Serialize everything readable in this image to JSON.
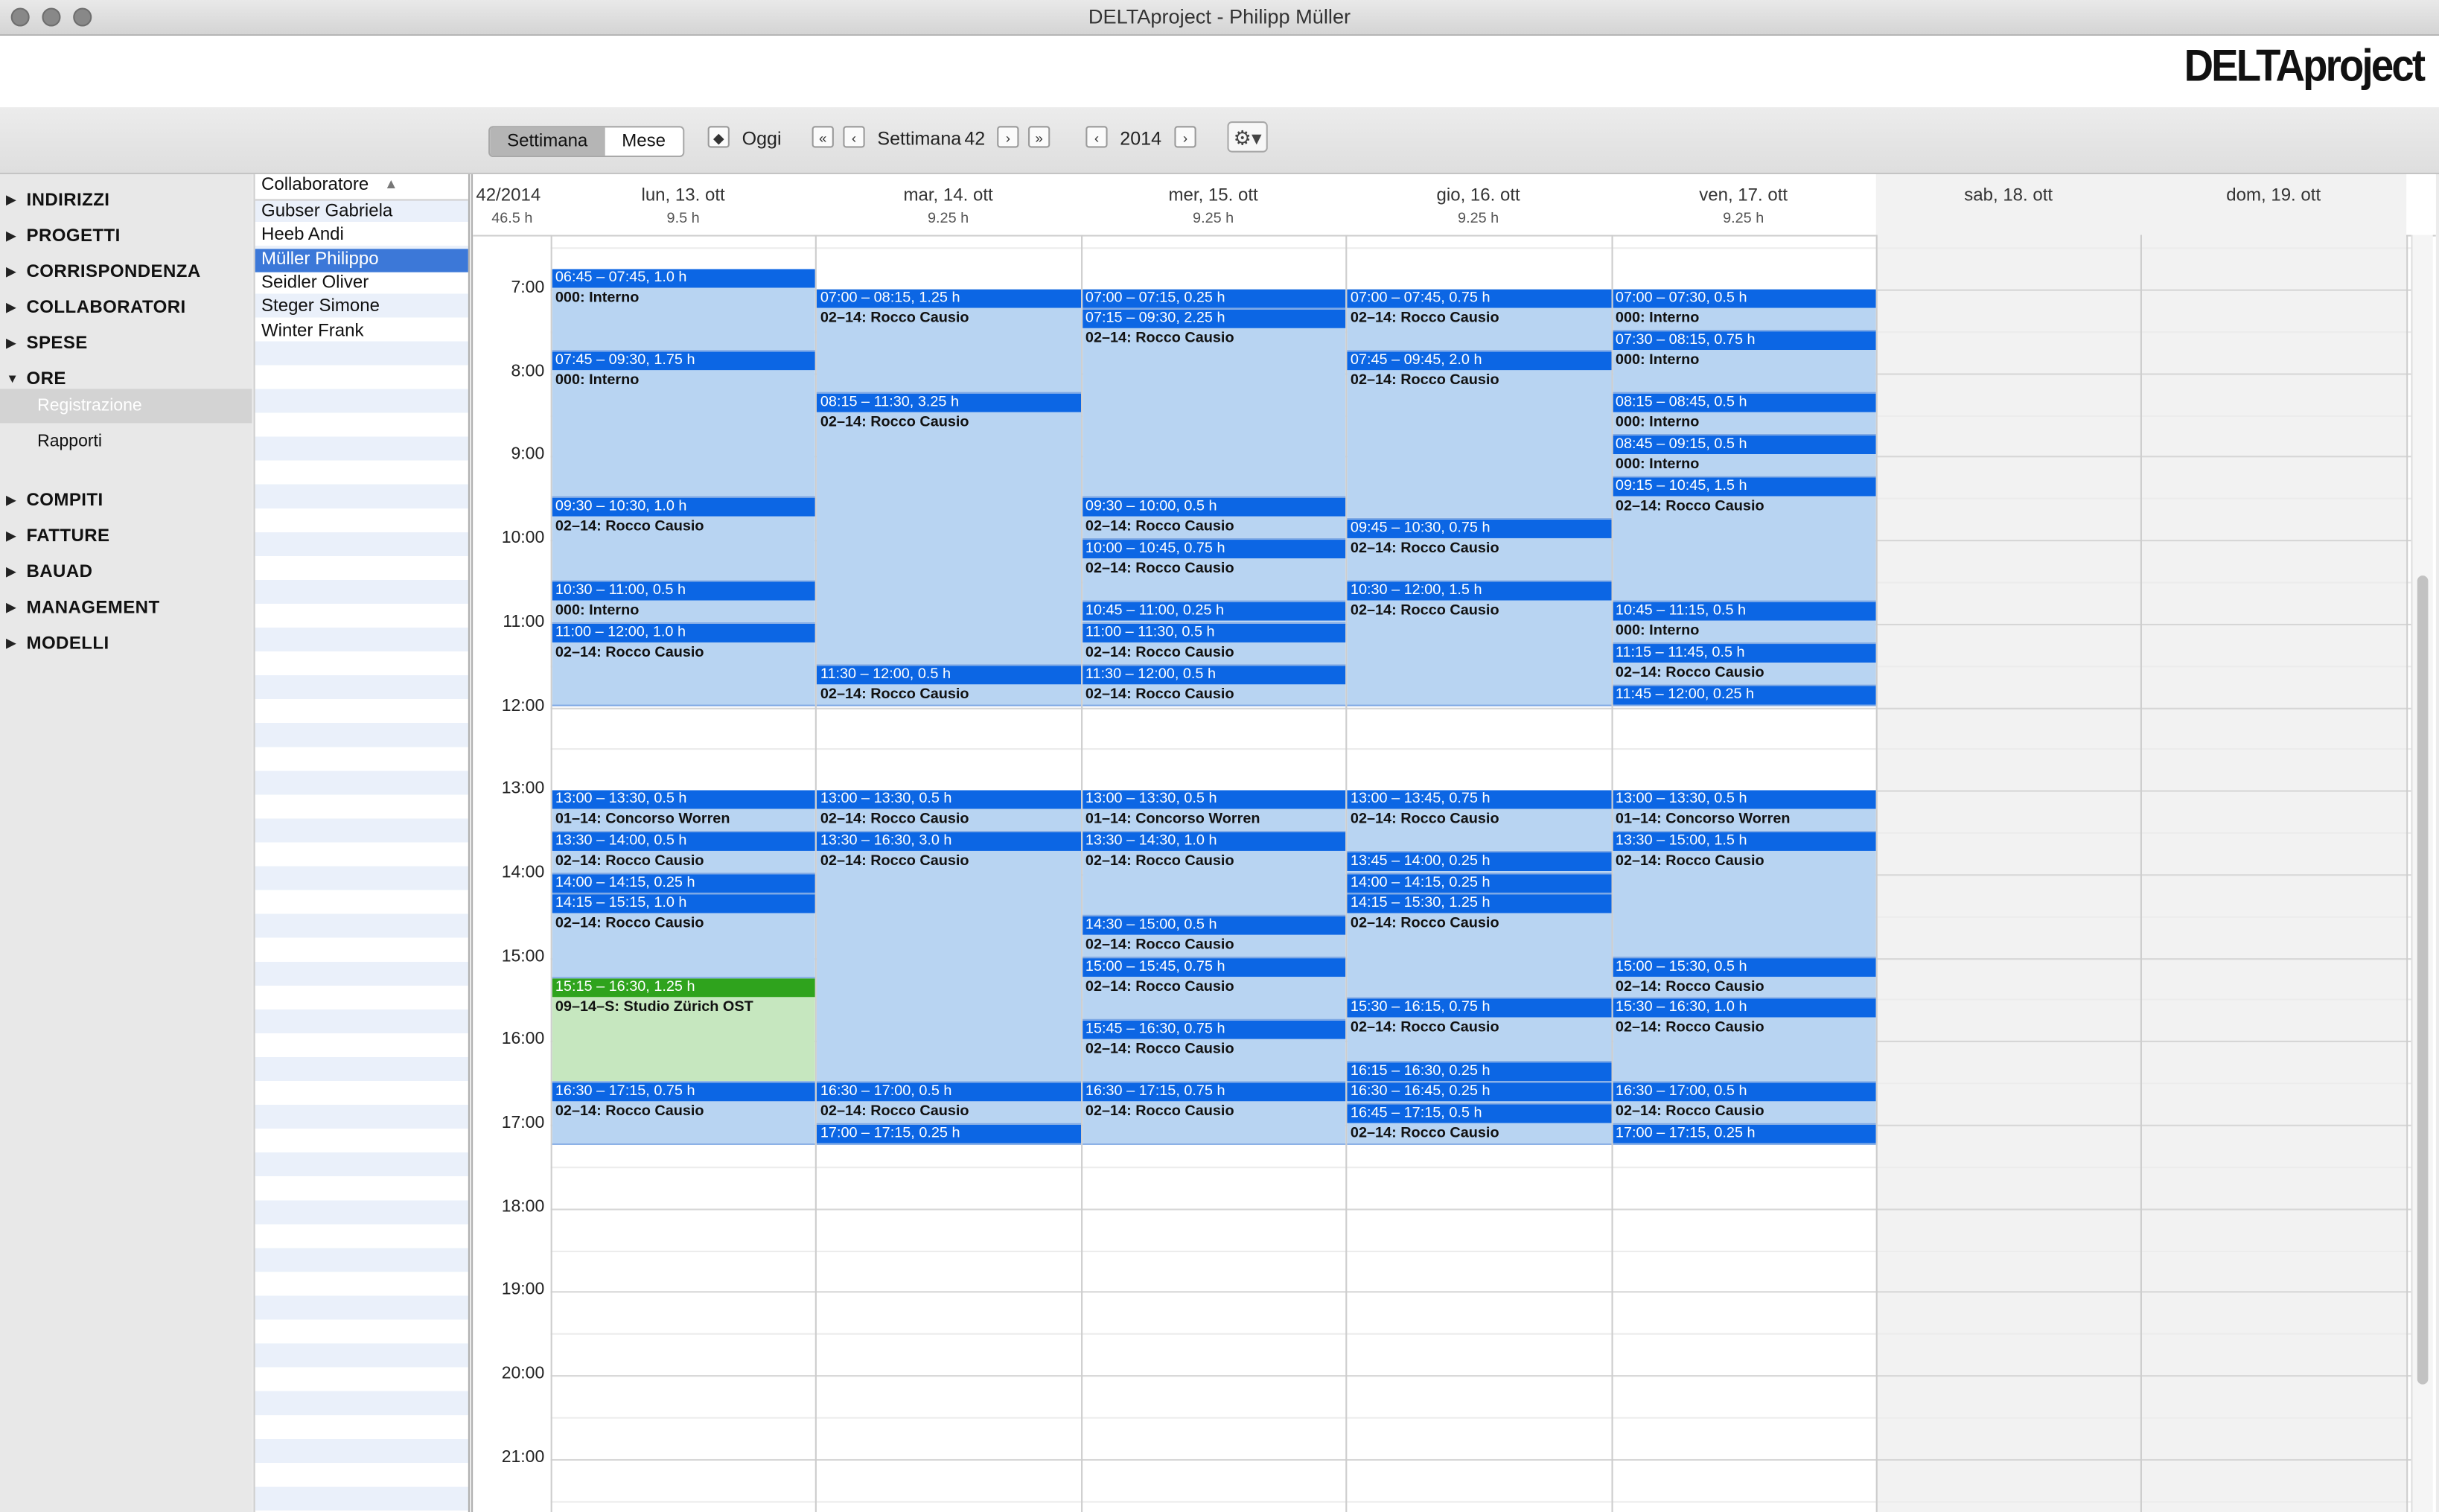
{
  "window": {
    "title": "DELTAproject - Philipp Müller"
  },
  "brand": {
    "logo_text": "DELTAproject"
  },
  "toolbar": {
    "view_week": "Settimana",
    "view_month": "Mese",
    "today": "Oggi",
    "week_label": "Settimana",
    "week_number": "42",
    "year": "2014"
  },
  "nav": {
    "items": [
      {
        "label": "INDIRIZZI",
        "expanded": false
      },
      {
        "label": "PROGETTI",
        "expanded": false
      },
      {
        "label": "CORRISPONDENZA",
        "expanded": false
      },
      {
        "label": "COLLABORATORI",
        "expanded": false
      },
      {
        "label": "SPESE",
        "expanded": false
      },
      {
        "label": "ORE",
        "expanded": true
      },
      {
        "label": "COMPITI",
        "expanded": false
      },
      {
        "label": "FATTURE",
        "expanded": false
      },
      {
        "label": "BAUAD",
        "expanded": false
      },
      {
        "label": "MANAGEMENT",
        "expanded": false
      },
      {
        "label": "MODELLI",
        "expanded": false
      }
    ],
    "sub_items": [
      {
        "label": "Registrazione",
        "selected": true
      },
      {
        "label": "Rapporti",
        "selected": false
      }
    ]
  },
  "collaborators": {
    "header": "Collaboratore",
    "rows": [
      "Gubser Gabriela",
      "Heeb Andi",
      "Müller Philippo",
      "Seidler Oliver",
      "Steger Simone",
      "Winter Frank"
    ],
    "selected_index": 2
  },
  "calendar": {
    "week_label": "42/2014",
    "week_total": "46.5 h",
    "days": [
      {
        "label": "lun, 13. ott",
        "hours": "9.5 h",
        "weekend": false
      },
      {
        "label": "mar, 14. ott",
        "hours": "9.25 h",
        "weekend": false
      },
      {
        "label": "mer, 15. ott",
        "hours": "9.25 h",
        "weekend": false
      },
      {
        "label": "gio, 16. ott",
        "hours": "9.25 h",
        "weekend": false
      },
      {
        "label": "ven, 17. ott",
        "hours": "9.25 h",
        "weekend": false
      },
      {
        "label": "sab, 18. ott",
        "hours": "",
        "weekend": true
      },
      {
        "label": "dom, 19. ott",
        "hours": "",
        "weekend": true
      }
    ],
    "hours": [
      "7:00",
      "8:00",
      "9:00",
      "10:00",
      "11:00",
      "12:00",
      "13:00",
      "14:00",
      "15:00",
      "16:00",
      "17:00",
      "18:00",
      "19:00",
      "20:00",
      "21:00"
    ],
    "events": [
      {
        "day": 0,
        "start": "06:45",
        "end": "07:45",
        "label": "06:45 – 07:45, 1.0 h",
        "task": "000: Interno"
      },
      {
        "day": 0,
        "start": "07:45",
        "end": "09:30",
        "label": "07:45 – 09:30, 1.75 h",
        "task": "000: Interno"
      },
      {
        "day": 0,
        "start": "09:30",
        "end": "10:30",
        "label": "09:30 – 10:30, 1.0 h",
        "task": "02–14: Rocco Causio"
      },
      {
        "day": 0,
        "start": "10:30",
        "end": "11:00",
        "label": "10:30 – 11:00, 0.5 h",
        "task": "000: Interno"
      },
      {
        "day": 0,
        "start": "11:00",
        "end": "12:00",
        "label": "11:00 – 12:00, 1.0 h",
        "task": "02–14: Rocco Causio"
      },
      {
        "day": 0,
        "start": "13:00",
        "end": "13:30",
        "label": "13:00 – 13:30, 0.5 h",
        "task": "01–14: Concorso Worren"
      },
      {
        "day": 0,
        "start": "13:30",
        "end": "14:00",
        "label": "13:30 – 14:00, 0.5 h",
        "task": "02–14: Rocco Causio"
      },
      {
        "day": 0,
        "start": "14:00",
        "end": "14:15",
        "label": "14:00 – 14:15, 0.25 h",
        "task": ""
      },
      {
        "day": 0,
        "start": "14:15",
        "end": "15:15",
        "label": "14:15 – 15:15, 1.0 h",
        "task": "02–14: Rocco Causio"
      },
      {
        "day": 0,
        "start": "15:15",
        "end": "16:30",
        "label": "15:15 – 16:30, 1.25 h",
        "task": "09–14–S: Studio Zürich OST",
        "color": "green"
      },
      {
        "day": 0,
        "start": "16:30",
        "end": "17:15",
        "label": "16:30 – 17:15, 0.75 h",
        "task": "02–14: Rocco Causio"
      },
      {
        "day": 1,
        "start": "07:00",
        "end": "08:15",
        "label": "07:00 – 08:15, 1.25 h",
        "task": "02–14: Rocco Causio"
      },
      {
        "day": 1,
        "start": "08:15",
        "end": "11:30",
        "label": "08:15 – 11:30, 3.25 h",
        "task": "02–14: Rocco Causio"
      },
      {
        "day": 1,
        "start": "11:30",
        "end": "12:00",
        "label": "11:30 – 12:00, 0.5 h",
        "task": "02–14: Rocco Causio"
      },
      {
        "day": 1,
        "start": "13:00",
        "end": "13:30",
        "label": "13:00 – 13:30, 0.5 h",
        "task": "02–14: Rocco Causio"
      },
      {
        "day": 1,
        "start": "13:30",
        "end": "16:30",
        "label": "13:30 – 16:30, 3.0 h",
        "task": "02–14: Rocco Causio"
      },
      {
        "day": 1,
        "start": "16:30",
        "end": "17:00",
        "label": "16:30 – 17:00, 0.5 h",
        "task": "02–14: Rocco Causio"
      },
      {
        "day": 1,
        "start": "17:00",
        "end": "17:15",
        "label": "17:00 – 17:15, 0.25 h",
        "task": ""
      },
      {
        "day": 2,
        "start": "07:00",
        "end": "07:15",
        "label": "07:00 – 07:15, 0.25 h",
        "task": ""
      },
      {
        "day": 2,
        "start": "07:15",
        "end": "09:30",
        "label": "07:15 – 09:30, 2.25 h",
        "task": "02–14: Rocco Causio"
      },
      {
        "day": 2,
        "start": "09:30",
        "end": "10:00",
        "label": "09:30 – 10:00, 0.5 h",
        "task": "02–14: Rocco Causio"
      },
      {
        "day": 2,
        "start": "10:00",
        "end": "10:45",
        "label": "10:00 – 10:45, 0.75 h",
        "task": "02–14: Rocco Causio"
      },
      {
        "day": 2,
        "start": "10:45",
        "end": "11:00",
        "label": "10:45 – 11:00, 0.25 h",
        "task": ""
      },
      {
        "day": 2,
        "start": "11:00",
        "end": "11:30",
        "label": "11:00 – 11:30, 0.5 h",
        "task": "02–14: Rocco Causio"
      },
      {
        "day": 2,
        "start": "11:30",
        "end": "12:00",
        "label": "11:30 – 12:00, 0.5 h",
        "task": "02–14: Rocco Causio"
      },
      {
        "day": 2,
        "start": "13:00",
        "end": "13:30",
        "label": "13:00 – 13:30, 0.5 h",
        "task": "01–14: Concorso Worren"
      },
      {
        "day": 2,
        "start": "13:30",
        "end": "14:30",
        "label": "13:30 – 14:30, 1.0 h",
        "task": "02–14: Rocco Causio"
      },
      {
        "day": 2,
        "start": "14:30",
        "end": "15:00",
        "label": "14:30 – 15:00, 0.5 h",
        "task": "02–14: Rocco Causio"
      },
      {
        "day": 2,
        "start": "15:00",
        "end": "15:45",
        "label": "15:00 – 15:45, 0.75 h",
        "task": "02–14: Rocco Causio"
      },
      {
        "day": 2,
        "start": "15:45",
        "end": "16:30",
        "label": "15:45 – 16:30, 0.75 h",
        "task": "02–14: Rocco Causio"
      },
      {
        "day": 2,
        "start": "16:30",
        "end": "17:15",
        "label": "16:30 – 17:15, 0.75 h",
        "task": "02–14: Rocco Causio"
      },
      {
        "day": 3,
        "start": "07:00",
        "end": "07:45",
        "label": "07:00 – 07:45, 0.75 h",
        "task": "02–14: Rocco Causio"
      },
      {
        "day": 3,
        "start": "07:45",
        "end": "09:45",
        "label": "07:45 – 09:45, 2.0 h",
        "task": "02–14: Rocco Causio"
      },
      {
        "day": 3,
        "start": "09:45",
        "end": "10:30",
        "label": "09:45 – 10:30, 0.75 h",
        "task": "02–14: Rocco Causio"
      },
      {
        "day": 3,
        "start": "10:30",
        "end": "12:00",
        "label": "10:30 – 12:00, 1.5 h",
        "task": "02–14: Rocco Causio"
      },
      {
        "day": 3,
        "start": "13:00",
        "end": "13:45",
        "label": "13:00 – 13:45, 0.75 h",
        "task": "02–14: Rocco Causio"
      },
      {
        "day": 3,
        "start": "13:45",
        "end": "14:00",
        "label": "13:45 – 14:00, 0.25 h",
        "task": ""
      },
      {
        "day": 3,
        "start": "14:00",
        "end": "14:15",
        "label": "14:00 – 14:15, 0.25 h",
        "task": ""
      },
      {
        "day": 3,
        "start": "14:15",
        "end": "15:30",
        "label": "14:15 – 15:30, 1.25 h",
        "task": "02–14: Rocco Causio"
      },
      {
        "day": 3,
        "start": "15:30",
        "end": "16:15",
        "label": "15:30 – 16:15, 0.75 h",
        "task": "02–14: Rocco Causio"
      },
      {
        "day": 3,
        "start": "16:15",
        "end": "16:30",
        "label": "16:15 – 16:30, 0.25 h",
        "task": ""
      },
      {
        "day": 3,
        "start": "16:30",
        "end": "16:45",
        "label": "16:30 – 16:45, 0.25 h",
        "task": ""
      },
      {
        "day": 3,
        "start": "16:45",
        "end": "17:15",
        "label": "16:45 – 17:15, 0.5 h",
        "task": "02–14: Rocco Causio"
      },
      {
        "day": 4,
        "start": "07:00",
        "end": "07:30",
        "label": "07:00 – 07:30, 0.5 h",
        "task": "000: Interno"
      },
      {
        "day": 4,
        "start": "07:30",
        "end": "08:15",
        "label": "07:30 – 08:15, 0.75 h",
        "task": "000: Interno"
      },
      {
        "day": 4,
        "start": "08:15",
        "end": "08:45",
        "label": "08:15 – 08:45, 0.5 h",
        "task": "000: Interno"
      },
      {
        "day": 4,
        "start": "08:45",
        "end": "09:15",
        "label": "08:45 – 09:15, 0.5 h",
        "task": "000: Interno"
      },
      {
        "day": 4,
        "start": "09:15",
        "end": "10:45",
        "label": "09:15 – 10:45, 1.5 h",
        "task": "02–14: Rocco Causio"
      },
      {
        "day": 4,
        "start": "10:45",
        "end": "11:15",
        "label": "10:45 – 11:15, 0.5 h",
        "task": "000: Interno"
      },
      {
        "day": 4,
        "start": "11:15",
        "end": "11:45",
        "label": "11:15 – 11:45, 0.5 h",
        "task": "02–14: Rocco Causio"
      },
      {
        "day": 4,
        "start": "11:45",
        "end": "12:00",
        "label": "11:45 – 12:00, 0.25 h",
        "task": ""
      },
      {
        "day": 4,
        "start": "13:00",
        "end": "13:30",
        "label": "13:00 – 13:30, 0.5 h",
        "task": "01–14: Concorso Worren"
      },
      {
        "day": 4,
        "start": "13:30",
        "end": "15:00",
        "label": "13:30 – 15:00, 1.5 h",
        "task": "02–14: Rocco Causio"
      },
      {
        "day": 4,
        "start": "15:00",
        "end": "15:30",
        "label": "15:00 – 15:30, 0.5 h",
        "task": "02–14: Rocco Causio"
      },
      {
        "day": 4,
        "start": "15:30",
        "end": "16:30",
        "label": "15:30 – 16:30, 1.0 h",
        "task": "02–14: Rocco Causio"
      },
      {
        "day": 4,
        "start": "16:30",
        "end": "17:00",
        "label": "16:30 – 17:00, 0.5 h",
        "task": "02–14: Rocco Causio"
      },
      {
        "day": 4,
        "start": "17:00",
        "end": "17:15",
        "label": "17:00 – 17:15, 0.25 h",
        "task": ""
      }
    ]
  },
  "colors": {
    "event_header": "#0c66e4",
    "event_body": "#b8d4f2",
    "event_green_header": "#2fa31d",
    "event_green_body": "#c6e7bf",
    "selection": "#3c78d8"
  }
}
